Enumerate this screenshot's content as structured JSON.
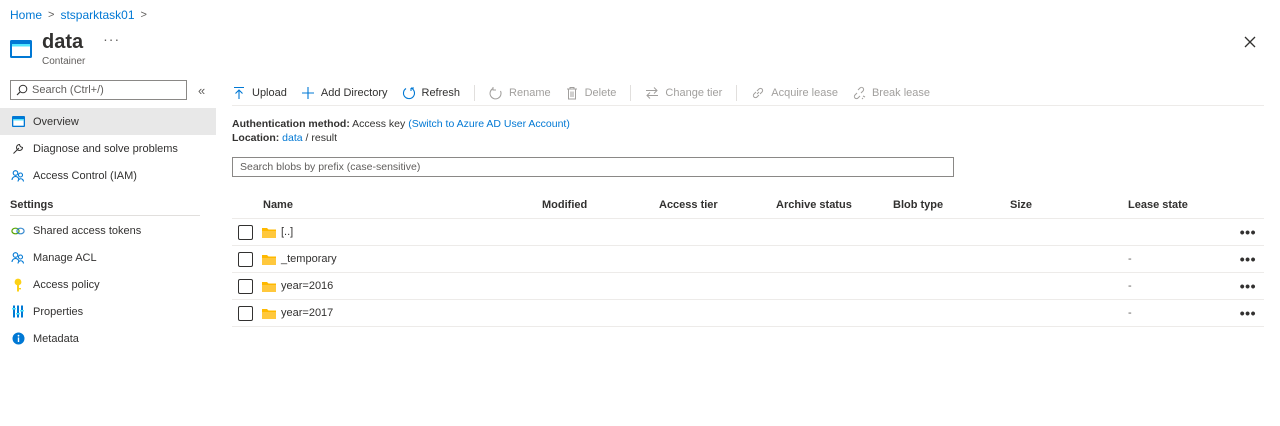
{
  "breadcrumb": {
    "home": "Home",
    "account": "stsparktask01",
    "sep": ">"
  },
  "header": {
    "title": "data",
    "subtitle": "Container",
    "more": "···"
  },
  "sidebar": {
    "search_placeholder": "Search (Ctrl+/)",
    "collapse": "«",
    "items": [
      {
        "label": "Overview",
        "icon": "container-icon"
      },
      {
        "label": "Diagnose and solve problems",
        "icon": "wrench-icon"
      },
      {
        "label": "Access Control (IAM)",
        "icon": "people-icon"
      }
    ],
    "settings_section": "Settings",
    "settings_items": [
      {
        "label": "Shared access tokens",
        "icon": "link-icon"
      },
      {
        "label": "Manage ACL",
        "icon": "people-icon"
      },
      {
        "label": "Access policy",
        "icon": "key-icon"
      },
      {
        "label": "Properties",
        "icon": "properties-icon"
      },
      {
        "label": "Metadata",
        "icon": "info-icon"
      }
    ]
  },
  "toolbar": {
    "upload": "Upload",
    "add_directory": "Add Directory",
    "refresh": "Refresh",
    "rename": "Rename",
    "delete": "Delete",
    "change_tier": "Change tier",
    "acquire_lease": "Acquire lease",
    "break_lease": "Break lease"
  },
  "info": {
    "auth_label": "Authentication method:",
    "auth_value": "Access key",
    "auth_link": "(Switch to Azure AD User Account)",
    "location_label": "Location:",
    "location_link": "data",
    "location_sep": "/",
    "location_path": "result"
  },
  "blob_search_placeholder": "Search blobs by prefix (case-sensitive)",
  "table": {
    "columns": [
      "Name",
      "Modified",
      "Access tier",
      "Archive status",
      "Blob type",
      "Size",
      "Lease state"
    ],
    "rows": [
      {
        "name": "[..]",
        "lease": ""
      },
      {
        "name": "_temporary",
        "lease": "-"
      },
      {
        "name": "year=2016",
        "lease": "-"
      },
      {
        "name": "year=2017",
        "lease": "-"
      }
    ],
    "row_menu": "•••"
  },
  "colors": {
    "accent": "#0078d4",
    "folder": "#ffb900",
    "key": "#fcd116"
  }
}
